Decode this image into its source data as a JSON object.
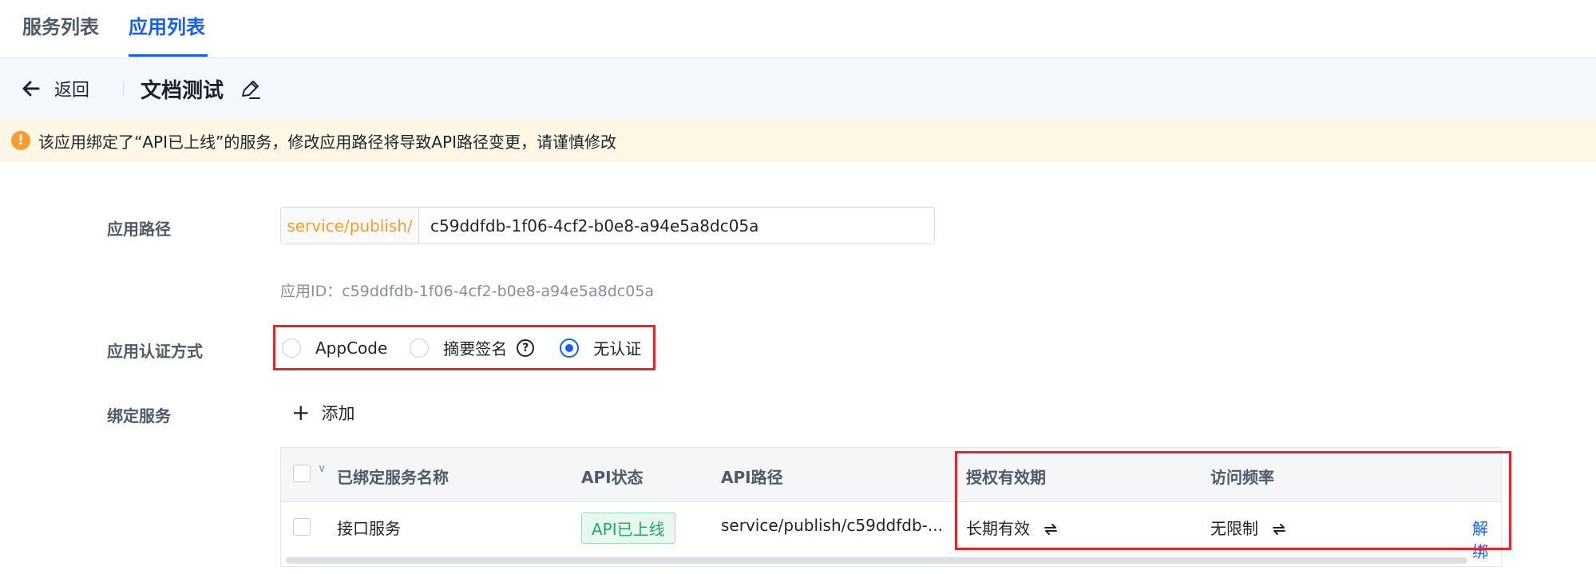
{
  "tabs": [
    {
      "label": "服务列表",
      "active": false
    },
    {
      "label": "应用列表",
      "active": true
    }
  ],
  "header": {
    "back_label": "返回",
    "title": "文档测试"
  },
  "alert": {
    "text": "该应用绑定了“API已上线”的服务，修改应用路径将导致API路径变更，请谨慎修改"
  },
  "form": {
    "path_label": "应用路径",
    "path_prefix": "service/publish/",
    "path_value": "c59ddfdb-1f06-4cf2-b0e8-a94e5a8dc05a",
    "app_id_text": "应用ID：c59ddfdb-1f06-4cf2-b0e8-a94e5a8dc05a",
    "auth_label": "应用认证方式",
    "auth_options": [
      {
        "label": "AppCode",
        "checked": false
      },
      {
        "label": "摘要签名",
        "checked": false
      },
      {
        "label": "无认证",
        "checked": true
      }
    ],
    "help_glyph": "?",
    "bind_label": "绑定服务",
    "add_label": "添加"
  },
  "table": {
    "columns": [
      "已绑定服务名称",
      "API状态",
      "API路径",
      "授权有效期",
      "访问频率"
    ],
    "rows": [
      {
        "name": "接口服务",
        "status": "API已上线",
        "path": "service/publish/c59ddfdb-...",
        "validity": "长期有效",
        "rate": "无限制",
        "action": "解绑"
      }
    ]
  },
  "colors": {
    "accent": "#165dff",
    "warning": "#ff9a2e",
    "success": "#23a66a",
    "highlight": "#e5262b"
  }
}
